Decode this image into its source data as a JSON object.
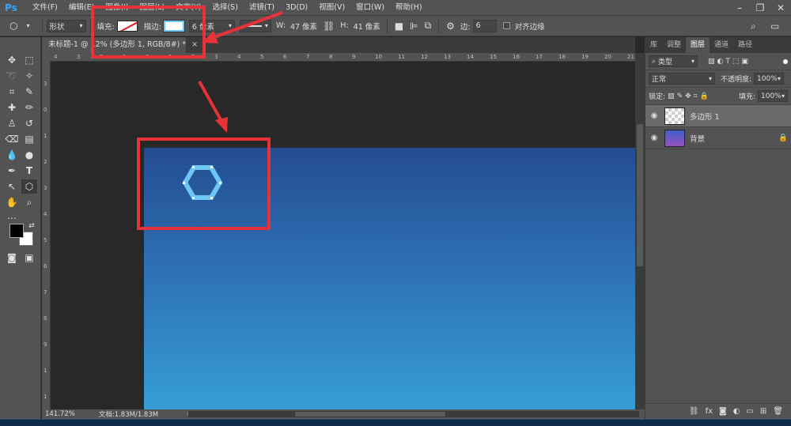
{
  "app": {
    "logo": "Ps"
  },
  "menu": [
    "文件(F)",
    "编辑(E)",
    "图像(I)",
    "图层(L)",
    "文字(Y)",
    "选择(S)",
    "滤镜(T)",
    "3D(D)",
    "视图(V)",
    "窗口(W)",
    "帮助(H)"
  ],
  "window_controls": {
    "minimize": "–",
    "restore": "❐",
    "close": "✕"
  },
  "options": {
    "mode": "形状",
    "fill_label": "填充:",
    "stroke_label": "描边:",
    "stroke_width": "6 像素",
    "w_label": "W:",
    "w_value": "47 像素",
    "h_label": "H:",
    "h_value": "41 像素",
    "sides_label": "边:",
    "sides_value": "6",
    "align_edges": "对齐边缘",
    "stroke_color": "#6ec6f5"
  },
  "document": {
    "tab_title": "未标题-1 @ 1",
    "tab_title_rest": "2% (多边形 1, RGB/8#) *",
    "close": "×"
  },
  "ruler": {
    "top": [
      "4",
      "3",
      "2",
      "1",
      "0",
      "1",
      "2",
      "3",
      "4",
      "5",
      "6",
      "7",
      "8",
      "9",
      "10",
      "11",
      "12",
      "13",
      "14",
      "15",
      "16",
      "17",
      "18",
      "19",
      "20",
      "21"
    ],
    "left": [
      "3",
      "0",
      "1",
      "2",
      "3",
      "4",
      "5",
      "6",
      "7",
      "8",
      "9",
      "1",
      "1"
    ]
  },
  "status": {
    "zoom": "141.72%",
    "doc": "文档:1.83M/1.83M",
    "arrow": "›"
  },
  "panels": {
    "tabs": [
      "库",
      "调整",
      "图层",
      "通道",
      "路径"
    ],
    "active_tab": "图层",
    "filter_kind": "类型",
    "blend_mode": "正常",
    "opacity_label": "不透明度:",
    "opacity_value": "100%",
    "lock_label": "锁定:",
    "fill_label": "填充:",
    "fill_value": "100%",
    "layers": [
      {
        "name": "多边形 1",
        "selected": true
      },
      {
        "name": "背景",
        "selected": false,
        "locked": true
      }
    ]
  },
  "colors": {
    "accent": "#31a8ff",
    "annotation": "#e8323a",
    "gradient_top": "#244d90",
    "gradient_bottom": "#36a0d6"
  }
}
